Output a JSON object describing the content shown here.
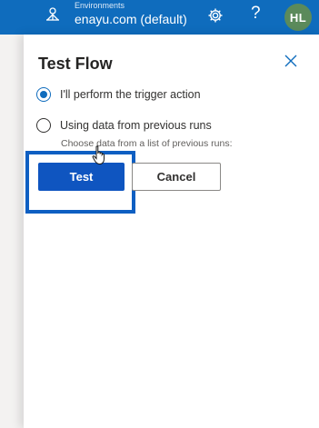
{
  "header": {
    "environment_caption": "Environments",
    "environment_name": "enayu.com (default)",
    "help_glyph": "?",
    "avatar_initials": "HL",
    "icons": {
      "environment": "environment-icon",
      "settings": "gear-icon"
    }
  },
  "panel": {
    "title": "Test Flow",
    "close_icon": "close-icon",
    "options": [
      {
        "label": "I'll perform the trigger action",
        "checked": true
      },
      {
        "label": "Using data from previous runs",
        "checked": false
      }
    ],
    "previous_runs_note": "Choose data from a list of previous runs:",
    "test_label": "Test",
    "cancel_label": "Cancel"
  },
  "colors": {
    "header_bg": "#0f6cbd",
    "primary_button": "#0f55c0",
    "focus_ring": "#0e5fc2",
    "avatar_bg": "#5b8a5b"
  }
}
